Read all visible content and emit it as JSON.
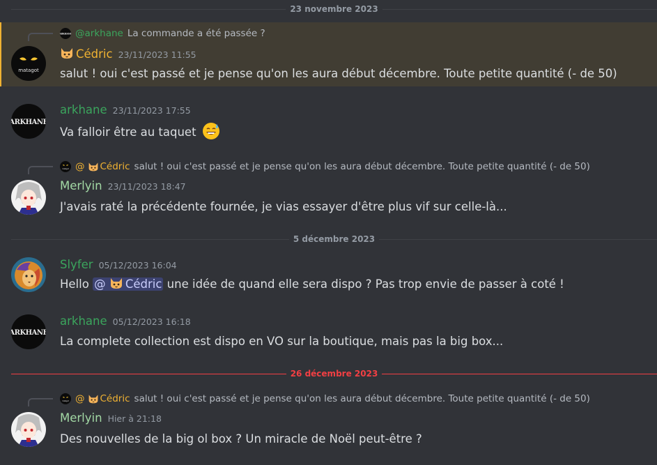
{
  "dividers": {
    "d1": "23 novembre 2023",
    "d2": "5 décembre 2023",
    "d3": "26 décembre 2023"
  },
  "colors": {
    "cedric": "#f0b232",
    "arkhane": "#3ba55d",
    "merlyin": "#a3d9a5",
    "slyfer": "#3ba55d",
    "new_divider": "#f23f43"
  },
  "messages": [
    {
      "reply": {
        "at": "@arkhane",
        "text": "La commande a été passée ?"
      },
      "author": "Cédric",
      "avatar_icon": "matagot-avatar-icon",
      "avatar_text": "matagot",
      "timestamp": "23/11/2023 11:55",
      "content": "salut ! oui c'est passé et je pense qu'on les aura début décembre. Toute petite quantité (- de 50)"
    },
    {
      "author": "arkhane",
      "avatar_icon": "arkhane-avatar-icon",
      "avatar_text": "ARKHANE",
      "timestamp": "23/11/2023 17:55",
      "content": "Va falloir être au taquet",
      "emoji": "sweat-smile-emoji"
    },
    {
      "reply": {
        "at": "@",
        "name": "Cédric",
        "text": "salut ! oui c'est passé et je pense qu'on les aura début décembre. Toute petite quantité (- de 50)"
      },
      "author": "Merlyin",
      "avatar_icon": "merlyin-avatar-icon",
      "timestamp": "23/11/2023 18:47",
      "content": "J'avais raté la précédente fournée, je vias essayer d'être plus vif sur celle-là..."
    },
    {
      "author": "Slyfer",
      "avatar_icon": "slyfer-lion-avatar-icon",
      "timestamp": "05/12/2023 16:04",
      "content_pre": "Hello",
      "mention": {
        "at": "@",
        "name": "Cédric"
      },
      "content_post": "une idée de quand elle sera dispo ? Pas trop envie de passer à coté !"
    },
    {
      "author": "arkhane",
      "avatar_icon": "arkhane-avatar-icon",
      "avatar_text": "ARKHANE",
      "timestamp": "05/12/2023 16:18",
      "content": "La complete collection est dispo en VO sur la boutique, mais pas la big box..."
    },
    {
      "reply": {
        "at": "@",
        "name": "Cédric",
        "text": "salut ! oui c'est passé et je pense qu'on les aura début décembre. Toute petite quantité (- de 50)"
      },
      "author": "Merlyin",
      "avatar_icon": "merlyin-avatar-icon",
      "timestamp": "Hier à 21:18",
      "content": "Des nouvelles de la big ol box ? Un miracle de Noël peut-être ?"
    }
  ]
}
